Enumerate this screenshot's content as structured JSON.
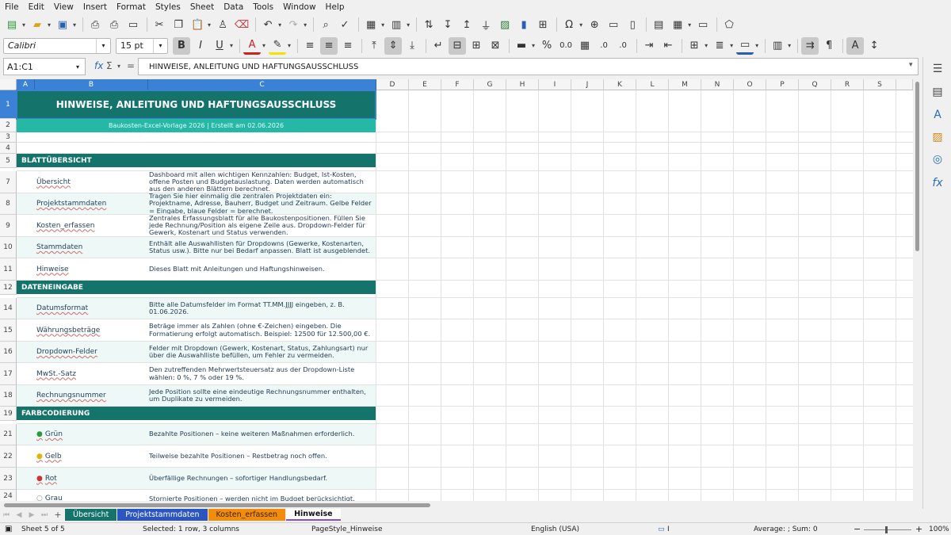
{
  "menu": [
    "File",
    "Edit",
    "View",
    "Insert",
    "Format",
    "Styles",
    "Sheet",
    "Data",
    "Tools",
    "Window",
    "Help"
  ],
  "toolbar": {
    "font_name": "Calibri",
    "font_size": "15 pt",
    "bold": "B",
    "italic": "I",
    "underline": "U"
  },
  "formula_bar": {
    "cell_ref": "A1:C1",
    "fx": "fx",
    "sigma": "Σ",
    "equals": "=",
    "content": "HINWEISE, ANLEITUNG UND HAFTUNGSAUSSCHLUSS"
  },
  "columns": [
    "A",
    "B",
    "C",
    "D",
    "E",
    "F",
    "G",
    "H",
    "I",
    "J",
    "K",
    "L",
    "M",
    "N",
    "O",
    "P",
    "Q",
    "R",
    "S"
  ],
  "rows": [
    "1",
    "2",
    "3",
    "4",
    "5",
    "7",
    "8",
    "9",
    "10",
    "11",
    "12",
    "14",
    "15",
    "16",
    "17",
    "18",
    "19",
    "21",
    "22",
    "23",
    "24"
  ],
  "sheet": {
    "title": "HINWEISE, ANLEITUNG UND HAFTUNGSAUSSCHLUSS",
    "subtitle": "Baukosten-Excel-Vorlage 2026  |  Erstellt am 02.06.2026",
    "sections": {
      "overview": "BLATTÜBERSICHT",
      "input": "DATENEINGABE",
      "colors": "FARBCODIERUNG"
    },
    "overview_rows": [
      {
        "name": "Übersicht",
        "desc": "Dashboard mit allen wichtigen Kennzahlen: Budget, Ist-Kosten, offene Posten und Budgetauslastung. Daten werden automatisch aus den anderen Blättern berechnet."
      },
      {
        "name": "Projektstammdaten",
        "desc": "Tragen Sie hier einmalig die zentralen Projektdaten ein: Projektname, Adresse, Bauherr, Budget und Zeitraum. Gelbe Felder = Eingabe, blaue Felder = berechnet."
      },
      {
        "name": "Kosten_erfassen",
        "desc": "Zentrales Erfassungsblatt für alle Baukostenpositionen. Füllen Sie jede Rechnung/Position als eigene Zeile aus. Dropdown-Felder für Gewerk, Kostenart und Status verwenden."
      },
      {
        "name": "Stammdaten",
        "desc": "Enthält alle Auswahllisten für Dropdowns (Gewerke, Kostenarten, Status usw.). Bitte nur bei Bedarf anpassen. Blatt ist ausgeblendet."
      },
      {
        "name": "Hinweise",
        "desc": "Dieses Blatt mit Anleitungen und Haftungshinweisen."
      }
    ],
    "input_rows": [
      {
        "name": "Datumsformat",
        "desc": "Bitte alle Datumsfelder im Format TT.MM.JJJJ eingeben, z. B. 01.06.2026."
      },
      {
        "name": "Währungsbeträge",
        "desc": "Beträge immer als Zahlen (ohne €-Zeichen) eingeben. Die Formatierung erfolgt automatisch. Beispiel: 12500 für 12.500,00 €."
      },
      {
        "name": "Dropdown-Felder",
        "desc": "Felder mit Dropdown (Gewerk, Kostenart, Status, Zahlungsart) nur über die Auswahlliste befüllen, um Fehler zu vermeiden."
      },
      {
        "name": "MwSt.-Satz",
        "desc": "Den zutreffenden Mehrwertsteuersatz aus der Dropdown-Liste wählen: 0 %, 7 % oder 19 %."
      },
      {
        "name": "Rechnungsnummer",
        "desc": "Jede Position sollte eine eindeutige Rechnungsnummer enthalten, um Duplikate zu vermeiden."
      }
    ],
    "color_rows": [
      {
        "name": "Grün",
        "desc": "Bezahlte Positionen – keine weiteren Maßnahmen erforderlich."
      },
      {
        "name": "Gelb",
        "desc": "Teilweise bezahlte Positionen – Restbetrag noch offen."
      },
      {
        "name": "Rot",
        "desc": "Überfällige Rechnungen – sofortiger Handlungsbedarf."
      },
      {
        "name": "Grau",
        "desc": "Stornierte Positionen – werden nicht im Budget berücksichtigt."
      }
    ]
  },
  "tabs": [
    "Übersicht",
    "Projektstammdaten",
    "Kosten_erfassen",
    "Hinweise"
  ],
  "status": {
    "sheet": "Sheet 5 of 5",
    "selection": "Selected: 1 row, 3 columns",
    "page_style": "PageStyle_Hinweise",
    "language": "English (USA)",
    "sum": "Average: ; Sum: 0",
    "zoom": "100%"
  },
  "colors": {
    "title": "#14736b",
    "subtitle": "#25b8a6",
    "selection": "#3b82d6"
  }
}
